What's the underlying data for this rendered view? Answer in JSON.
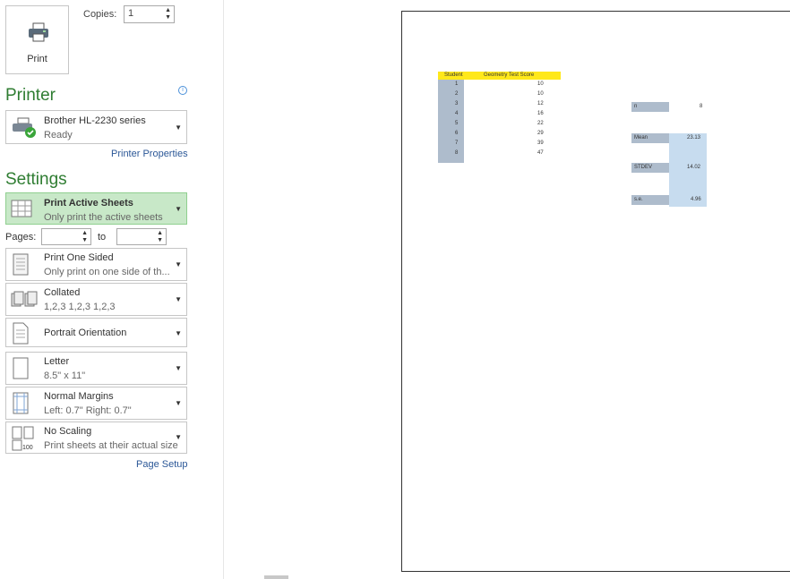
{
  "print_button": {
    "label": "Print"
  },
  "copies": {
    "label": "Copies:",
    "value": "1"
  },
  "printer": {
    "title": "Printer",
    "name": "Brother HL-2230 series",
    "status": "Ready",
    "properties_link": "Printer Properties"
  },
  "settings": {
    "title": "Settings",
    "active_sheets": {
      "title": "Print Active Sheets",
      "sub": "Only print the active sheets"
    },
    "pages": {
      "label": "Pages:",
      "to_label": "to",
      "from": "",
      "to": ""
    },
    "sided": {
      "title": "Print One Sided",
      "sub": "Only print on one side of th..."
    },
    "collated": {
      "title": "Collated",
      "sub": "1,2,3   1,2,3   1,2,3"
    },
    "orientation": {
      "title": "Portrait Orientation"
    },
    "paper": {
      "title": "Letter",
      "sub": "8.5\" x 11\""
    },
    "margins": {
      "title": "Normal Margins",
      "sub": "Left: 0.7\"    Right: 0.7\""
    },
    "scaling": {
      "title": "No Scaling",
      "sub": "Print sheets at their actual size"
    },
    "page_setup_link": "Page Setup"
  },
  "preview": {
    "headers": {
      "student": "Student",
      "score": "Geometry Test Score"
    },
    "rows": [
      {
        "student": "1",
        "score": "10"
      },
      {
        "student": "2",
        "score": "10"
      },
      {
        "student": "3",
        "score": "12"
      },
      {
        "student": "4",
        "score": "16"
      },
      {
        "student": "5",
        "score": "22"
      },
      {
        "student": "6",
        "score": "29"
      },
      {
        "student": "7",
        "score": "39"
      },
      {
        "student": "8",
        "score": "47"
      }
    ],
    "stats": {
      "n_label": "n",
      "n_value": "8",
      "mean_label": "Mean",
      "mean_value": "23.13",
      "stdev_label": "STDEV",
      "stdev_value": "14.02",
      "se_label": "s.e.",
      "se_value": "4.96"
    }
  },
  "colors": {
    "accent_green": "#2f7d32",
    "selected_bg": "#c8e8c8",
    "header_yellow": "#ffe81a",
    "cell_blue": "#aebccc"
  },
  "icons": [
    "printer-icon",
    "printer-ready-icon",
    "info-icon",
    "sheet-grid-icon",
    "one-sided-icon",
    "collated-icon",
    "portrait-icon",
    "letter-icon",
    "margins-icon",
    "no-scaling-icon"
  ]
}
